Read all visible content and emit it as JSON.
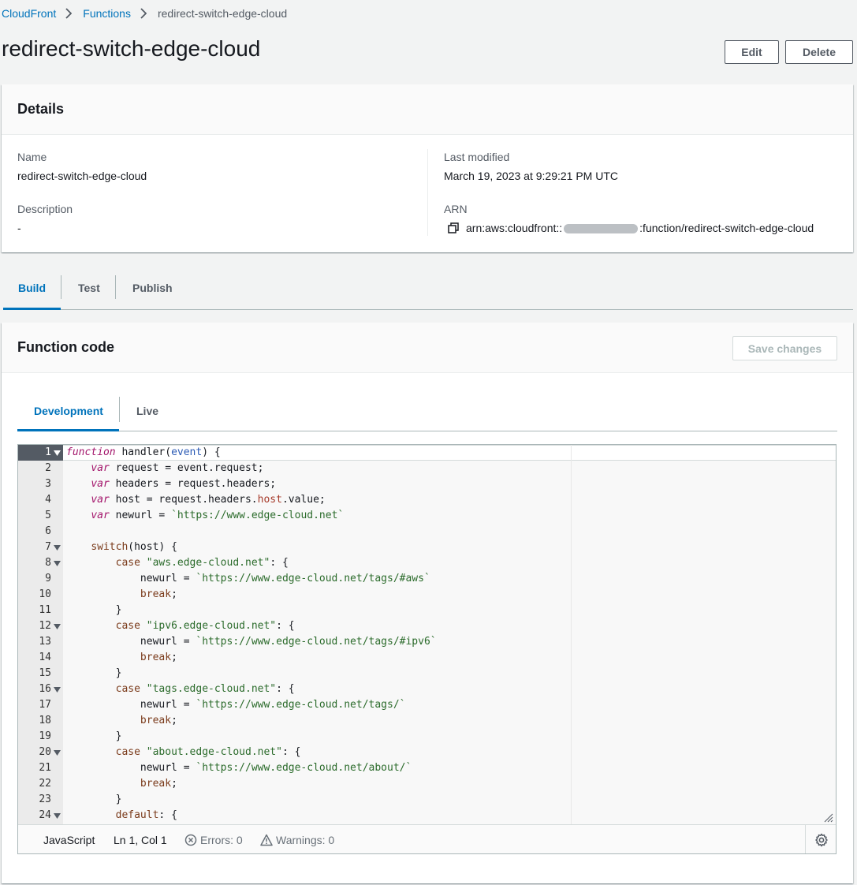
{
  "breadcrumb": {
    "items": [
      "CloudFront",
      "Functions"
    ],
    "current": "redirect-switch-edge-cloud"
  },
  "page": {
    "title": "redirect-switch-edge-cloud",
    "edit_label": "Edit",
    "delete_label": "Delete"
  },
  "details": {
    "title": "Details",
    "name_label": "Name",
    "name_value": "redirect-switch-edge-cloud",
    "description_label": "Description",
    "description_value": "-",
    "last_modified_label": "Last modified",
    "last_modified_value": "March 19, 2023 at 9:29:21 PM UTC",
    "arn_label": "ARN",
    "arn_prefix": "arn:aws:cloudfront::",
    "arn_suffix": ":function/redirect-switch-edge-cloud"
  },
  "tabs": [
    "Build",
    "Test",
    "Publish"
  ],
  "function_code": {
    "title": "Function code",
    "save_label": "Save changes",
    "subtabs": [
      "Development",
      "Live"
    ]
  },
  "editor": {
    "lines": [
      "1",
      "2",
      "3",
      "4",
      "5",
      "6",
      "7",
      "8",
      "9",
      "10",
      "11",
      "12",
      "13",
      "14",
      "15",
      "16",
      "17",
      "18",
      "19",
      "20",
      "21",
      "22",
      "23",
      "24"
    ],
    "fold_lines": [
      1,
      7,
      8,
      12,
      16,
      20,
      24
    ]
  },
  "statusbar": {
    "language": "JavaScript",
    "cursor": "Ln 1, Col 1",
    "errors": "Errors: 0",
    "warnings": "Warnings: 0"
  },
  "colors": {
    "link": "#0073bb",
    "keyword": "#a3156b",
    "string": "#2b6b2b"
  },
  "icons": [
    "chevron-right-icon",
    "copy-icon",
    "fold-arrow-icon",
    "error-circle-icon",
    "warning-triangle-icon",
    "settings-gear-icon",
    "resize-handle-icon"
  ]
}
